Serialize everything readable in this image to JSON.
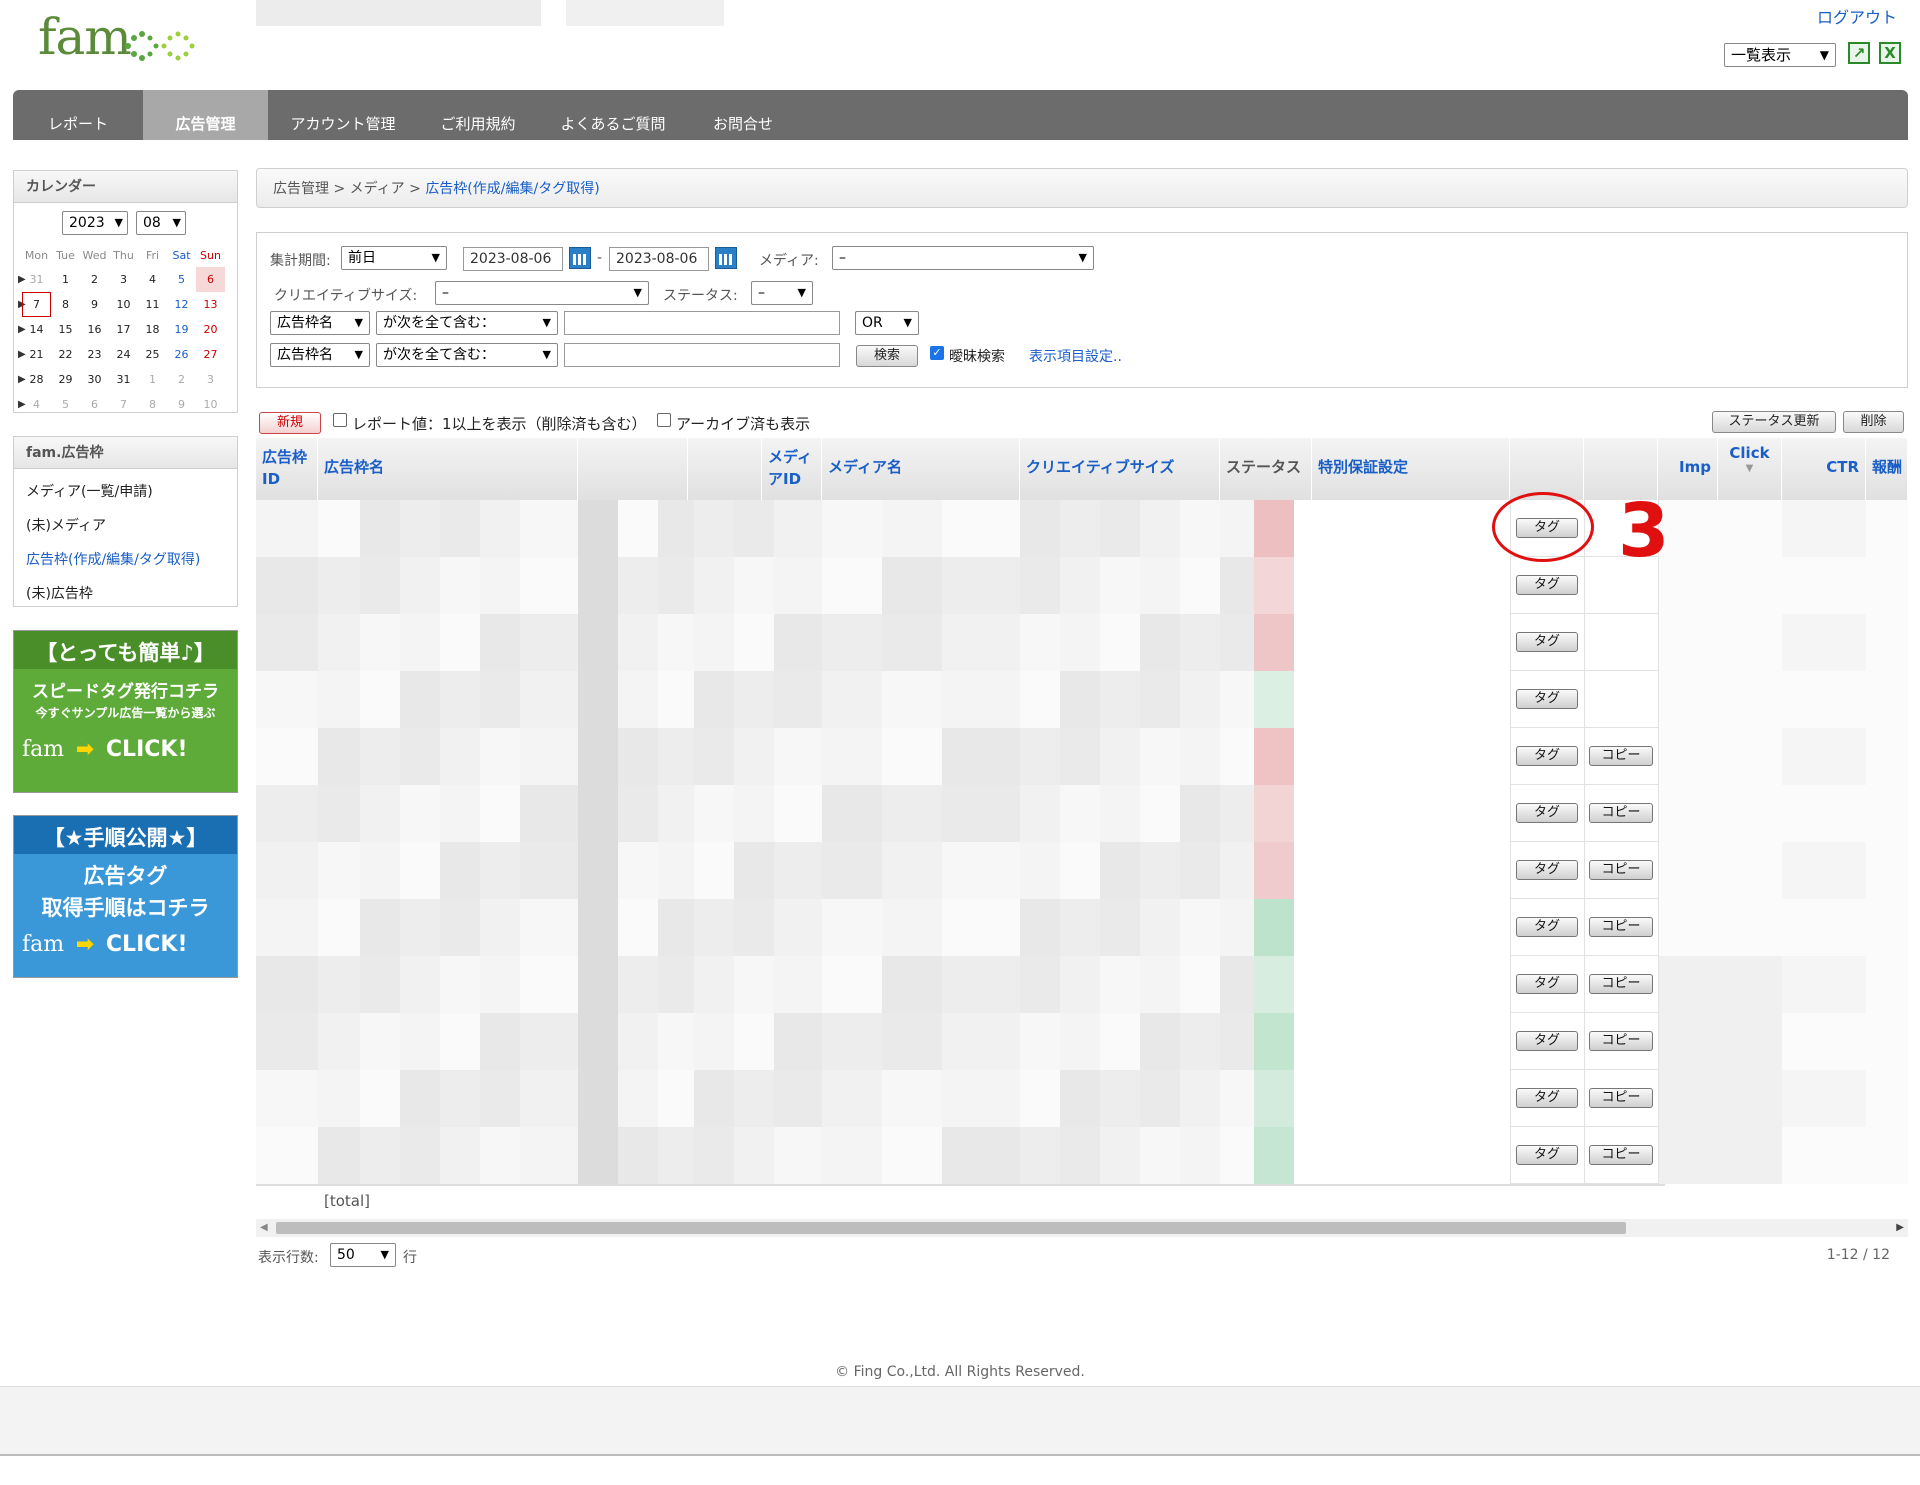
{
  "header": {
    "logo_text": "fam",
    "logout": "ログアウト",
    "view_select": "一覧表示",
    "excel_icon_1": "excel-export-icon",
    "excel_icon_2": "excel-icon"
  },
  "nav": {
    "items": [
      "レポート",
      "広告管理",
      "アカウント管理",
      "ご利用規約",
      "よくあるご質問",
      "お問合せ"
    ],
    "active_index": 1
  },
  "calendar": {
    "title": "カレンダー",
    "year": "2023",
    "month": "08",
    "weekdays": [
      "Mon",
      "Tue",
      "Wed",
      "Thu",
      "Fri",
      "Sat",
      "Sun"
    ],
    "weeks": [
      [
        "31",
        "1",
        "2",
        "3",
        "4",
        "5",
        "6"
      ],
      [
        "7",
        "8",
        "9",
        "10",
        "11",
        "12",
        "13"
      ],
      [
        "14",
        "15",
        "16",
        "17",
        "18",
        "19",
        "20"
      ],
      [
        "21",
        "22",
        "23",
        "24",
        "25",
        "26",
        "27"
      ],
      [
        "28",
        "29",
        "30",
        "31",
        "1",
        "2",
        "3"
      ],
      [
        "4",
        "5",
        "6",
        "7",
        "8",
        "9",
        "10"
      ]
    ],
    "today": "7"
  },
  "side_menu": {
    "title": "fam.広告枠",
    "items": [
      "メディア(一覧/申請)",
      "(未)メディア",
      "広告枠(作成/編集/タグ取得)",
      "(未)広告枠"
    ],
    "active_index": 2
  },
  "banners": {
    "speed": {
      "line1": "【とっても簡単♪】",
      "line2": "スピードタグ発行コチラ",
      "line3": "今すぐサンプル広告一覧から選ぶ",
      "logo": "fam",
      "cta": "CLICK!"
    },
    "guide": {
      "line1": "【★手順公開★】",
      "line2": "広告タグ",
      "line3": "取得手順はコチラ",
      "logo": "fam",
      "cta": "CLICK!"
    }
  },
  "breadcrumb": {
    "parts": [
      "広告管理",
      "メディア"
    ],
    "separator": ">",
    "current": "広告枠(作成/編集/タグ取得)"
  },
  "filters": {
    "period_label": "集計期間:",
    "period_value": "前日",
    "date_from": "2023-08-06",
    "date_to": "2023-08-06",
    "date_sep": "-",
    "media_label": "メディア:",
    "media_value": "–",
    "creative_label": "クリエイティブサイズ:",
    "creative_value": "–",
    "status_label": "ステータス:",
    "status_value": "–",
    "field1": "広告枠名",
    "op1": "が次を全て含む：",
    "logic": "OR",
    "field2": "広告枠名",
    "op2": "が次を全て含む：",
    "search_button": "検索",
    "fuzzy_label": "曖昧検索",
    "display_settings": "表示項目設定.."
  },
  "toolbar": {
    "new_button": "新規",
    "report_check_label": "レポート値：1以上を表示（削除済も含む）",
    "archive_check_label": "アーカイブ済も表示",
    "status_update_button": "ステータス更新",
    "delete_button": "削除"
  },
  "table": {
    "headers": {
      "slot_id": "広告枠ID",
      "slot_name": "広告枠名",
      "media_id": "メディアID",
      "media_name": "メディア名",
      "creative_size": "クリエイティブサイズ",
      "status": "ステータス",
      "special": "特別保証設定",
      "imp": "Imp",
      "click": "Click",
      "ctr": "CTR",
      "reward": "報酬"
    },
    "tag_label": "タグ",
    "copy_label": "コピー",
    "rows": [
      {
        "status_color": "#eebfc0",
        "has_copy": false
      },
      {
        "status_color": "#f3d6d7",
        "has_copy": false
      },
      {
        "status_color": "#efc6c8",
        "has_copy": false
      },
      {
        "status_color": "#dcefe3",
        "has_copy": false
      },
      {
        "status_color": "#efc2c3",
        "has_copy": true
      },
      {
        "status_color": "#f2d4d5",
        "has_copy": true
      },
      {
        "status_color": "#f0cbcd",
        "has_copy": true
      },
      {
        "status_color": "#bde3cc",
        "has_copy": true
      },
      {
        "status_color": "#d6ede0",
        "has_copy": true
      },
      {
        "status_color": "#c2e5d0",
        "has_copy": true
      },
      {
        "status_color": "#d3ebdd",
        "has_copy": true
      },
      {
        "status_color": "#c4e6d2",
        "has_copy": true
      }
    ],
    "total_label": "[total]"
  },
  "pagination": {
    "rows_label": "表示行数:",
    "rows_value": "50",
    "rows_unit": "行",
    "range": "1-12 / 12"
  },
  "annotation": {
    "step_number": "3"
  },
  "footer": {
    "copyright": "© Fing Co.,Ltd. All Rights Reserved."
  }
}
